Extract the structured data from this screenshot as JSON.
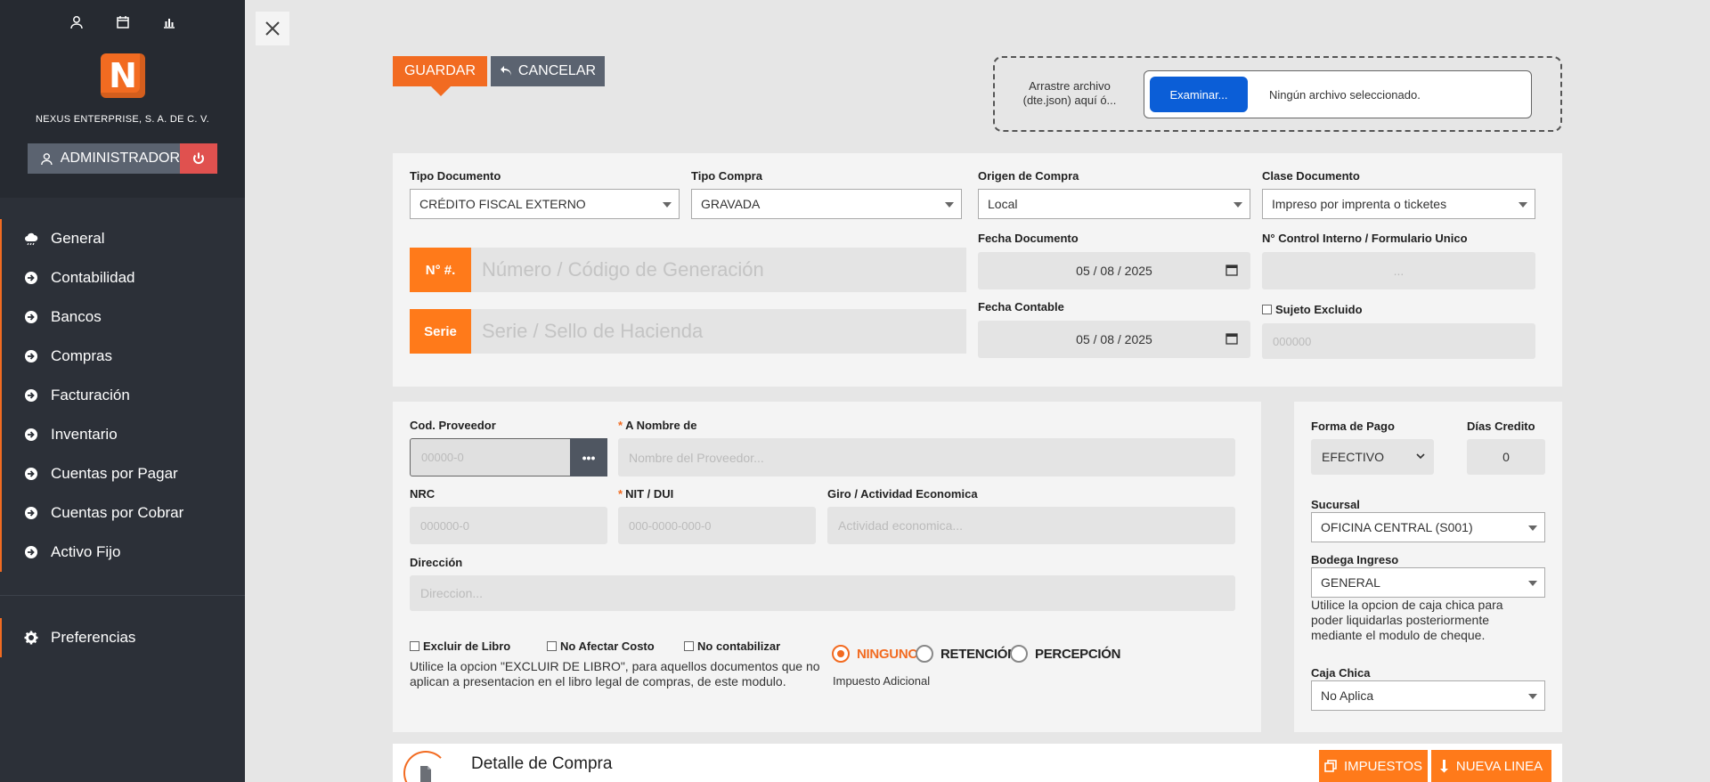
{
  "sidebar": {
    "company": "NEXUS ENTERPRISE, S. A. DE C. V.",
    "logo_letter": "N",
    "admin_label": "ADMINISTRADOR",
    "menu": [
      {
        "label": "General",
        "icon": "cloud-icon"
      },
      {
        "label": "Contabilidad",
        "icon": "arrow-circle-right-icon"
      },
      {
        "label": "Bancos",
        "icon": "arrow-circle-right-icon"
      },
      {
        "label": "Compras",
        "icon": "arrow-circle-right-icon"
      },
      {
        "label": "Facturación",
        "icon": "arrow-circle-right-icon"
      },
      {
        "label": "Inventario",
        "icon": "arrow-circle-right-icon"
      },
      {
        "label": "Cuentas por Pagar",
        "icon": "arrow-circle-right-icon"
      },
      {
        "label": "Cuentas por Cobrar",
        "icon": "arrow-circle-right-icon"
      },
      {
        "label": "Activo Fijo",
        "icon": "arrow-circle-right-icon"
      }
    ],
    "preferences": "Preferencias"
  },
  "actions": {
    "save": "GUARDAR",
    "cancel": "CANCELAR"
  },
  "upload": {
    "drop_text": "Arrastre archivo (dte.json) aquí ó...",
    "browse": "Examinar...",
    "no_file": "Ningún archivo seleccionado."
  },
  "document": {
    "tipo_documento_label": "Tipo Documento",
    "tipo_documento": "CRÉDITO FISCAL EXTERNO",
    "tipo_compra_label": "Tipo Compra",
    "tipo_compra": "GRAVADA",
    "origen_label": "Origen de Compra",
    "origen": "Local",
    "clase_label": "Clase Documento",
    "clase": "Impreso por imprenta o ticketes",
    "numero_addon": "N° #.",
    "numero_placeholder": "Número / Código de Generación",
    "serie_addon": "Serie",
    "serie_placeholder": "Serie / Sello de Hacienda",
    "fecha_doc_label": "Fecha Documento",
    "fecha_doc": "05 / 08 / 2025",
    "fecha_contable_label": "Fecha Contable",
    "fecha_contable": "05 / 08 / 2025",
    "control_label": "N° Control Interno / Formulario Unico",
    "control_value": "...",
    "sujeto_label": "Sujeto Excluido",
    "sujeto_placeholder": "000000"
  },
  "provider": {
    "cod_label": "Cod. Proveedor",
    "cod_placeholder": "00000-0",
    "dots": "•••",
    "nombre_label": "A Nombre de",
    "nombre_placeholder": "Nombre del Proveedor...",
    "nrc_label": "NRC",
    "nrc_placeholder": "000000-0",
    "nit_label": "NIT / DUI",
    "nit_placeholder": "000-0000-000-0",
    "giro_label": "Giro / Actividad Economica",
    "giro_placeholder": "Actividad economica...",
    "direccion_label": "Dirección",
    "direccion_placeholder": "Direccion...",
    "excluir": "Excluir de Libro",
    "no_afectar": "No Afectar Costo",
    "no_contabilizar": "No contabilizar",
    "note": "Utilice la opcion \"EXCLUIR DE LIBRO\", para aquellos documentos que no aplican a presentacion en el libro legal de compras, de este modulo.",
    "radio_ninguno": "NINGUNO",
    "radio_retencion": "RETENCIÓN",
    "radio_percepcion": "PERCEPCIÓN",
    "impuesto_label": "Impuesto Adicional"
  },
  "payment": {
    "forma_label": "Forma de Pago",
    "forma": "EFECTIVO",
    "dias_label": "Días Credito",
    "dias": "0",
    "sucursal_label": "Sucursal",
    "sucursal": "OFICINA CENTRAL (S001)",
    "bodega_label": "Bodega Ingreso",
    "bodega": "GENERAL",
    "caja_note": "Utilice la opcion de caja chica para poder liquidarlas posteriormente mediante el modulo de cheque.",
    "caja_label": "Caja Chica",
    "caja": "No Aplica"
  },
  "detail": {
    "title": "Detalle de Compra",
    "impuestos": "IMPUESTOS",
    "nueva_linea": "NUEVA LINEA"
  },
  "colors": {
    "accent": "#f26b21",
    "sidebar": "#2c3038",
    "browse": "#0b5ed7"
  }
}
